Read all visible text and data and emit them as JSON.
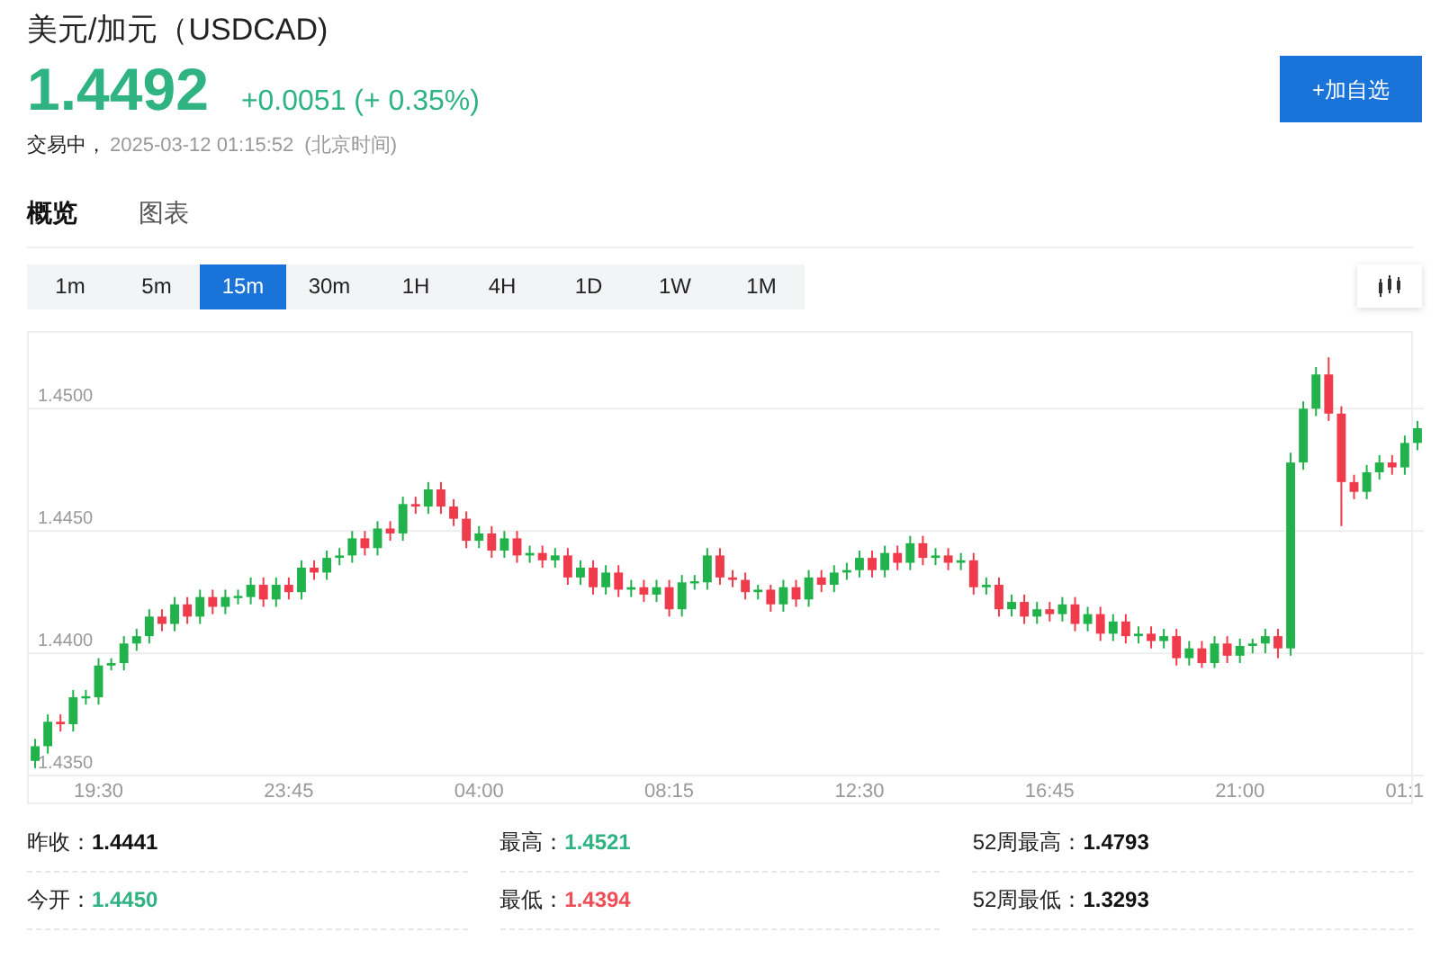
{
  "title": "美元/加元（USDCAD)",
  "price": {
    "value": "1.4492",
    "change": "+0.0051 (+ 0.35%)",
    "color": "#2fb383"
  },
  "status": {
    "label": "交易中，",
    "time": "2025-03-12 01:15:52",
    "zone": "(北京时间)"
  },
  "tabs": [
    {
      "label": "概览",
      "selected": true
    },
    {
      "label": "图表",
      "selected": false
    }
  ],
  "add_button": "+加自选",
  "periods": [
    {
      "label": "1m",
      "selected": false
    },
    {
      "label": "5m",
      "selected": false
    },
    {
      "label": "15m",
      "selected": true
    },
    {
      "label": "30m",
      "selected": false
    },
    {
      "label": "1H",
      "selected": false
    },
    {
      "label": "4H",
      "selected": false
    },
    {
      "label": "1D",
      "selected": false
    },
    {
      "label": "1W",
      "selected": false
    },
    {
      "label": "1M",
      "selected": false
    }
  ],
  "chart": {
    "chart_data": {
      "type": "candlestick",
      "grid": true,
      "ylim": [
        1.4339,
        1.4531
      ],
      "categories": [
        null,
        null,
        null,
        null,
        null,
        "19:30",
        null,
        null,
        null,
        null,
        null,
        null,
        null,
        null,
        null,
        null,
        null,
        null,
        null,
        null,
        "23:45",
        null,
        null,
        null,
        null,
        null,
        null,
        null,
        null,
        null,
        null,
        null,
        null,
        null,
        null,
        "04:00",
        null,
        null,
        null,
        null,
        null,
        null,
        null,
        null,
        null,
        null,
        null,
        null,
        null,
        null,
        "08:15",
        null,
        null,
        null,
        null,
        null,
        null,
        null,
        null,
        null,
        null,
        null,
        null,
        null,
        null,
        "12:30",
        null,
        null,
        null,
        null,
        null,
        null,
        null,
        null,
        null,
        null,
        null,
        null,
        null,
        null,
        "16:45",
        null,
        null,
        null,
        null,
        null,
        null,
        null,
        null,
        null,
        null,
        null,
        null,
        null,
        null,
        "21:00",
        null,
        null,
        null,
        null,
        null,
        null,
        null,
        null,
        null,
        null,
        null,
        null,
        "01:1",
        null
      ],
      "yticks": [
        {
          "value": 1.45,
          "label": "1.4500"
        },
        {
          "value": 1.445,
          "label": "1.4450"
        },
        {
          "value": 1.44,
          "label": "1.4400"
        },
        {
          "value": 1.435,
          "label": "1.4350"
        }
      ],
      "ohlc": [
        [
          1.4356,
          1.4365,
          1.4353,
          1.4362
        ],
        [
          1.4362,
          1.4375,
          1.4359,
          1.4372
        ],
        [
          1.4372,
          1.4375,
          1.4368,
          1.4371
        ],
        [
          1.4371,
          1.4385,
          1.4368,
          1.4382
        ],
        [
          1.4382,
          1.4385,
          1.4379,
          1.4382
        ],
        [
          1.4382,
          1.4398,
          1.4379,
          1.4395
        ],
        [
          1.4395,
          1.4398,
          1.4393,
          1.4396
        ],
        [
          1.4396,
          1.4407,
          1.4393,
          1.4404
        ],
        [
          1.4404,
          1.441,
          1.4401,
          1.4407
        ],
        [
          1.4407,
          1.4418,
          1.4404,
          1.4415
        ],
        [
          1.4415,
          1.4418,
          1.4409,
          1.4412
        ],
        [
          1.4412,
          1.4423,
          1.4409,
          1.442
        ],
        [
          1.442,
          1.4423,
          1.4412,
          1.4415
        ],
        [
          1.4415,
          1.4426,
          1.4412,
          1.4423
        ],
        [
          1.4423,
          1.4426,
          1.4416,
          1.4419
        ],
        [
          1.4419,
          1.4426,
          1.4416,
          1.4423
        ],
        [
          1.4423,
          1.4426,
          1.442,
          1.4423
        ],
        [
          1.4423,
          1.4431,
          1.442,
          1.4428
        ],
        [
          1.4428,
          1.4431,
          1.4419,
          1.4422
        ],
        [
          1.4422,
          1.4431,
          1.4419,
          1.4428
        ],
        [
          1.4428,
          1.4431,
          1.4422,
          1.4425
        ],
        [
          1.4425,
          1.4438,
          1.4422,
          1.4435
        ],
        [
          1.4435,
          1.4438,
          1.443,
          1.4433
        ],
        [
          1.4433,
          1.4442,
          1.443,
          1.4439
        ],
        [
          1.4439,
          1.4443,
          1.4436,
          1.444
        ],
        [
          1.444,
          1.445,
          1.4437,
          1.4447
        ],
        [
          1.4447,
          1.445,
          1.444,
          1.4443
        ],
        [
          1.4443,
          1.4454,
          1.444,
          1.4451
        ],
        [
          1.4451,
          1.4454,
          1.4446,
          1.4449
        ],
        [
          1.4449,
          1.4464,
          1.4446,
          1.4461
        ],
        [
          1.4461,
          1.4464,
          1.4457,
          1.446
        ],
        [
          1.446,
          1.447,
          1.4457,
          1.4467
        ],
        [
          1.4467,
          1.447,
          1.4457,
          1.446
        ],
        [
          1.446,
          1.4463,
          1.4452,
          1.4455
        ],
        [
          1.4455,
          1.4458,
          1.4443,
          1.4446
        ],
        [
          1.4446,
          1.4452,
          1.4443,
          1.4449
        ],
        [
          1.4449,
          1.4452,
          1.4439,
          1.4442
        ],
        [
          1.4442,
          1.445,
          1.4439,
          1.4447
        ],
        [
          1.4447,
          1.445,
          1.4437,
          1.444
        ],
        [
          1.444,
          1.4444,
          1.4437,
          1.4441
        ],
        [
          1.4441,
          1.4444,
          1.4435,
          1.4438
        ],
        [
          1.4438,
          1.4443,
          1.4435,
          1.444
        ],
        [
          1.444,
          1.4443,
          1.4428,
          1.4431
        ],
        [
          1.4431,
          1.4438,
          1.4428,
          1.4435
        ],
        [
          1.4435,
          1.4438,
          1.4424,
          1.4427
        ],
        [
          1.4427,
          1.4436,
          1.4424,
          1.4433
        ],
        [
          1.4433,
          1.4436,
          1.4423,
          1.4426
        ],
        [
          1.4426,
          1.443,
          1.4423,
          1.4427
        ],
        [
          1.4427,
          1.443,
          1.4421,
          1.4424
        ],
        [
          1.4424,
          1.443,
          1.4421,
          1.4427
        ],
        [
          1.4427,
          1.443,
          1.4415,
          1.4418
        ],
        [
          1.4418,
          1.4432,
          1.4415,
          1.4429
        ],
        [
          1.4429,
          1.4432,
          1.4426,
          1.4429
        ],
        [
          1.4429,
          1.4443,
          1.4426,
          1.444
        ],
        [
          1.444,
          1.4443,
          1.4428,
          1.4431
        ],
        [
          1.4431,
          1.4434,
          1.4427,
          1.443
        ],
        [
          1.443,
          1.4433,
          1.4422,
          1.4425
        ],
        [
          1.4425,
          1.4428,
          1.4422,
          1.4426
        ],
        [
          1.4426,
          1.4428,
          1.4417,
          1.442
        ],
        [
          1.442,
          1.443,
          1.4417,
          1.4427
        ],
        [
          1.4427,
          1.443,
          1.4419,
          1.4422
        ],
        [
          1.4422,
          1.4434,
          1.4419,
          1.4431
        ],
        [
          1.4431,
          1.4434,
          1.4425,
          1.4428
        ],
        [
          1.4428,
          1.4436,
          1.4425,
          1.4433
        ],
        [
          1.4433,
          1.4437,
          1.443,
          1.4434
        ],
        [
          1.4434,
          1.4442,
          1.4431,
          1.4439
        ],
        [
          1.4439,
          1.4442,
          1.4431,
          1.4434
        ],
        [
          1.4434,
          1.4444,
          1.4431,
          1.4441
        ],
        [
          1.4441,
          1.4444,
          1.4434,
          1.4437
        ],
        [
          1.4437,
          1.4448,
          1.4434,
          1.4445
        ],
        [
          1.4445,
          1.4448,
          1.4436,
          1.4439
        ],
        [
          1.4439,
          1.4443,
          1.4436,
          1.444
        ],
        [
          1.444,
          1.4443,
          1.4434,
          1.4437
        ],
        [
          1.4437,
          1.4441,
          1.4434,
          1.4438
        ],
        [
          1.4438,
          1.4441,
          1.4424,
          1.4427
        ],
        [
          1.4427,
          1.4431,
          1.4424,
          1.4428
        ],
        [
          1.4428,
          1.4431,
          1.4415,
          1.4418
        ],
        [
          1.4418,
          1.4424,
          1.4415,
          1.4421
        ],
        [
          1.4421,
          1.4424,
          1.4412,
          1.4415
        ],
        [
          1.4415,
          1.4421,
          1.4412,
          1.4418
        ],
        [
          1.4418,
          1.4421,
          1.4413,
          1.4416
        ],
        [
          1.4416,
          1.4423,
          1.4413,
          1.442
        ],
        [
          1.442,
          1.4423,
          1.4409,
          1.4412
        ],
        [
          1.4412,
          1.4419,
          1.4409,
          1.4416
        ],
        [
          1.4416,
          1.4419,
          1.4405,
          1.4408
        ],
        [
          1.4408,
          1.4416,
          1.4405,
          1.4413
        ],
        [
          1.4413,
          1.4416,
          1.4404,
          1.4407
        ],
        [
          1.4407,
          1.4411,
          1.4404,
          1.4408
        ],
        [
          1.4408,
          1.4411,
          1.4402,
          1.4405
        ],
        [
          1.4405,
          1.441,
          1.4402,
          1.4407
        ],
        [
          1.4407,
          1.441,
          1.4395,
          1.4398
        ],
        [
          1.4398,
          1.4405,
          1.4395,
          1.4402
        ],
        [
          1.4402,
          1.4405,
          1.4394,
          1.4396
        ],
        [
          1.4396,
          1.4407,
          1.4394,
          1.4404
        ],
        [
          1.4404,
          1.4407,
          1.4396,
          1.4399
        ],
        [
          1.4399,
          1.4406,
          1.4396,
          1.4403
        ],
        [
          1.4403,
          1.4406,
          1.44,
          1.4404
        ],
        [
          1.4404,
          1.441,
          1.44,
          1.4407
        ],
        [
          1.4407,
          1.441,
          1.4398,
          1.4402
        ],
        [
          1.4402,
          1.4482,
          1.4399,
          1.4478
        ],
        [
          1.4478,
          1.4503,
          1.4475,
          1.45
        ],
        [
          1.45,
          1.4517,
          1.4497,
          1.4514
        ],
        [
          1.4514,
          1.4521,
          1.4495,
          1.4498
        ],
        [
          1.4498,
          1.4501,
          1.4452,
          1.447
        ],
        [
          1.447,
          1.4473,
          1.4463,
          1.4466
        ],
        [
          1.4466,
          1.4477,
          1.4463,
          1.4474
        ],
        [
          1.4474,
          1.4481,
          1.4471,
          1.4478
        ],
        [
          1.4478,
          1.4481,
          1.4473,
          1.4476
        ],
        [
          1.4476,
          1.4489,
          1.4473,
          1.4486
        ],
        [
          1.4486,
          1.4495,
          1.4483,
          1.4492
        ]
      ]
    }
  },
  "stats": [
    {
      "label": "昨收：",
      "value": "1.4441",
      "color": "#111111"
    },
    {
      "label": "最高：",
      "value": "1.4521",
      "color": "#2fb383"
    },
    {
      "label": "52周最高：",
      "value": "1.4793",
      "color": "#111111"
    },
    {
      "label": "今开：",
      "value": "1.4450",
      "color": "#2fb383"
    },
    {
      "label": "最低：",
      "value": "1.4394",
      "color": "#ef4d57"
    },
    {
      "label": "52周最低：",
      "value": "1.3293",
      "color": "#111111"
    }
  ]
}
